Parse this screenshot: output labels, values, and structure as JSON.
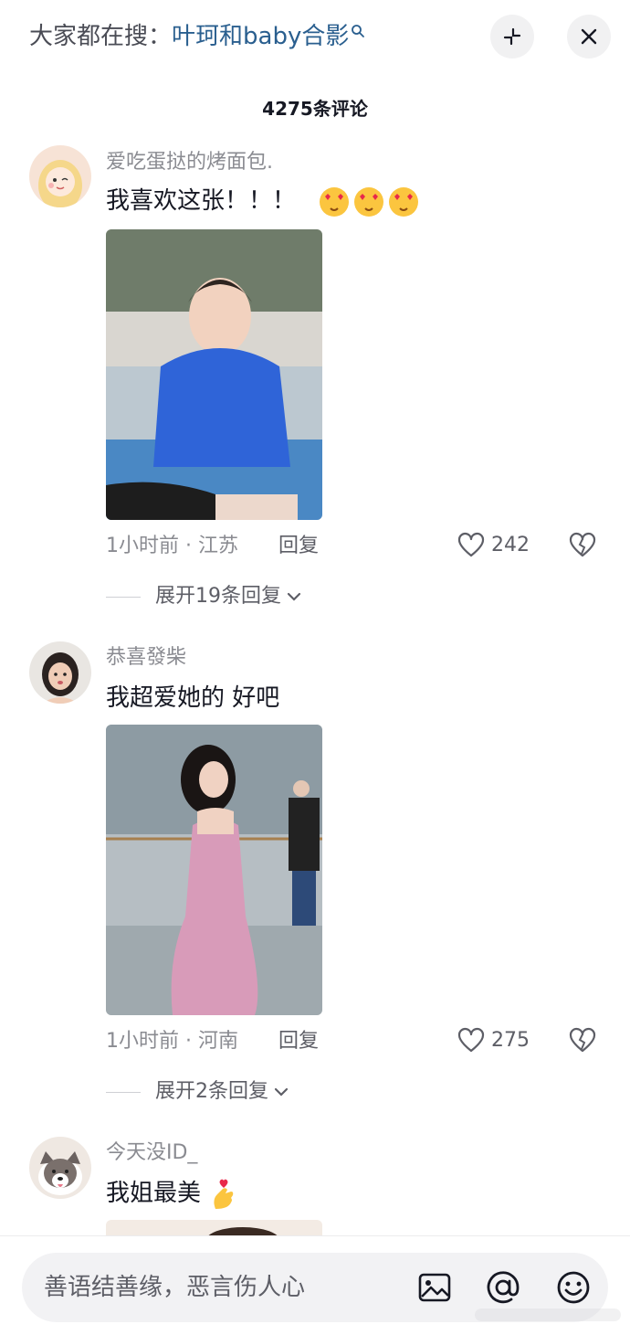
{
  "header": {
    "hot_search_prefix": "大家都在搜：",
    "hot_search_term": "叶珂和baby合影",
    "comment_count": "4275条评论"
  },
  "comments": [
    {
      "username": "爱吃蛋挞的烤面包.",
      "text": "我喜欢这张！！！",
      "time_location": "1小时前 · 江苏",
      "reply_label": "回复",
      "likes": "242",
      "expand_label": "展开19条回复"
    },
    {
      "username": "恭喜發柴",
      "text": "我超爱她的  好吧",
      "time_location": "1小时前 · 河南",
      "reply_label": "回复",
      "likes": "275",
      "expand_label": "展开2条回复"
    },
    {
      "username": "今天没ID_",
      "text": "我姐最美"
    }
  ],
  "input": {
    "placeholder": "善语结善缘，恶言伤人心"
  },
  "colors": {
    "accent_link": "#2a5f8f",
    "secondary_text": "#8a8b91",
    "primary_text": "#161823"
  },
  "icons": [
    "search-icon",
    "collapse-icon",
    "close-icon",
    "heart-icon",
    "broken-heart-icon",
    "chevron-down-icon",
    "image-icon",
    "at-icon",
    "emoji-icon",
    "heart-eyes-emoji",
    "finger-heart-emoji"
  ]
}
